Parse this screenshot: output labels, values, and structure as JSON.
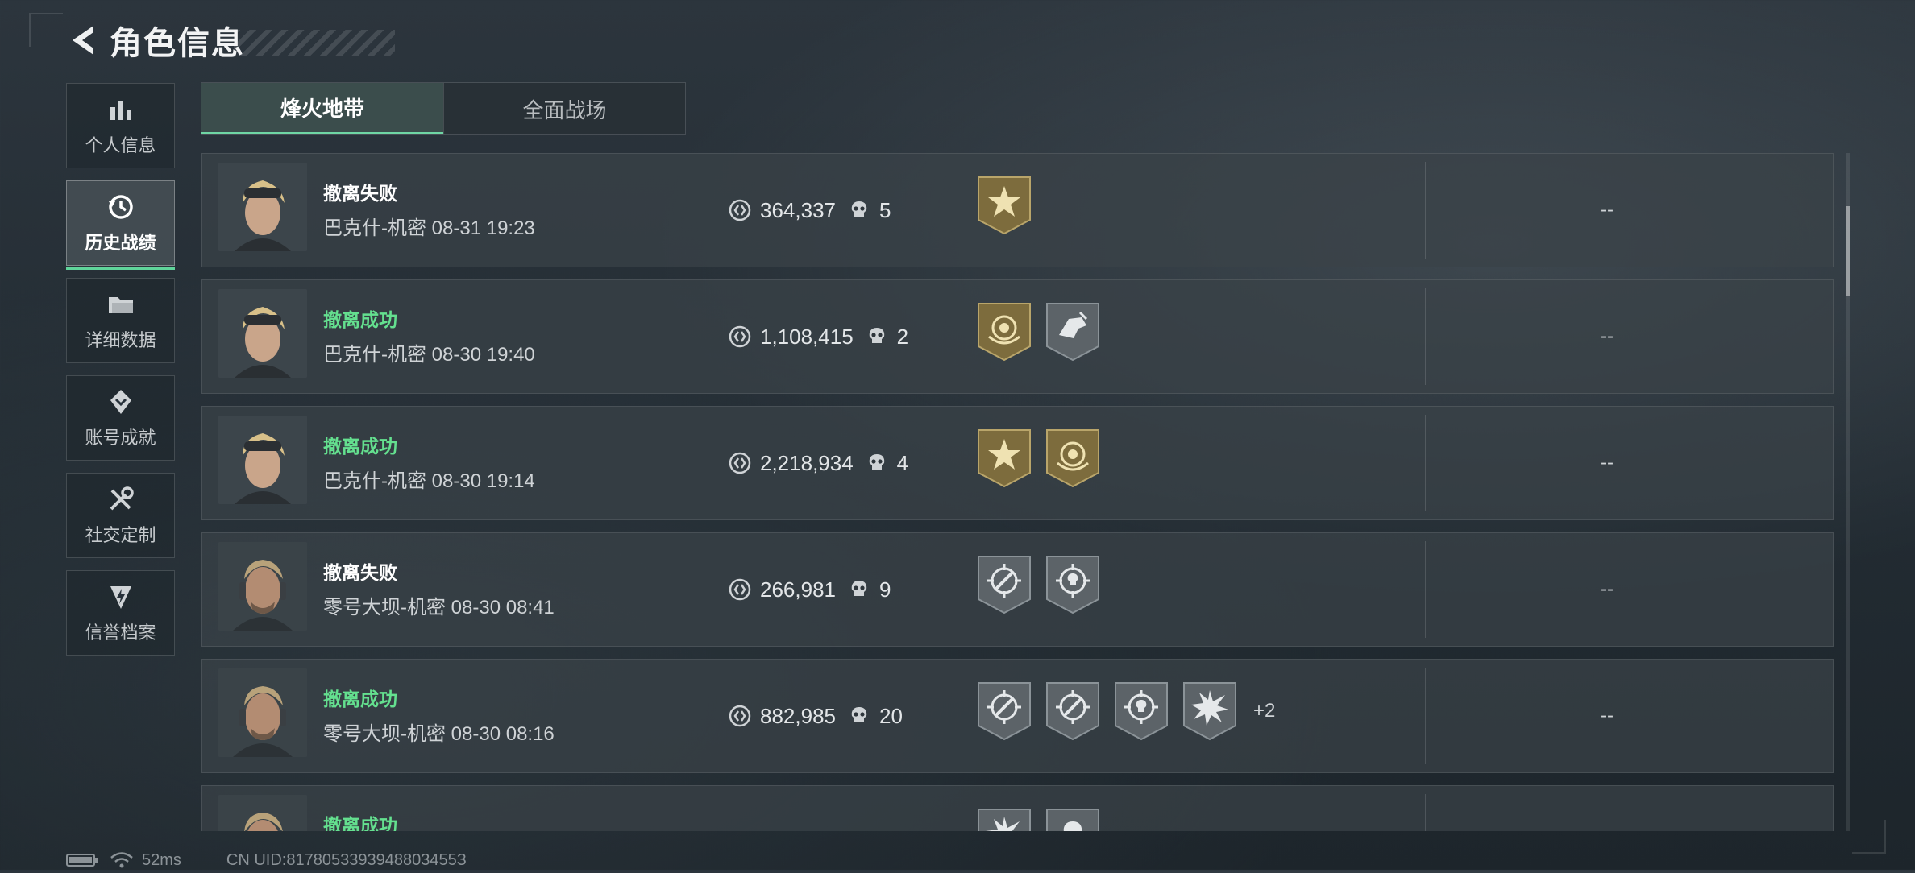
{
  "header": {
    "title": "角色信息"
  },
  "sidebar": {
    "items": [
      {
        "label": "个人信息",
        "icon": "bar-chart-icon"
      },
      {
        "label": "历史战绩",
        "icon": "history-clock-icon"
      },
      {
        "label": "详细数据",
        "icon": "folder-icon"
      },
      {
        "label": "账号成就",
        "icon": "achievement-icon"
      },
      {
        "label": "社交定制",
        "icon": "tools-icon"
      },
      {
        "label": "信誉档案",
        "icon": "shield-bolt-icon"
      }
    ],
    "active_index": 1
  },
  "tabs": [
    {
      "label": "烽火地带"
    },
    {
      "label": "全面战场"
    }
  ],
  "records": [
    {
      "status": "撤离失败",
      "map": "巴克什-机密",
      "time": "08-31 19:23",
      "value": "364,337",
      "kills": "5",
      "badges": [
        "gold-star-badge"
      ],
      "extra": "",
      "dash": "--"
    },
    {
      "status": "撤离成功",
      "map": "巴克什-机密",
      "time": "08-30 19:40",
      "value": "1,108,415",
      "kills": "2",
      "badges": [
        "gold-laurel-badge",
        "silver-hand-badge"
      ],
      "extra": "",
      "dash": "--"
    },
    {
      "status": "撤离成功",
      "map": "巴克什-机密",
      "time": "08-30 19:14",
      "value": "2,218,934",
      "kills": "4",
      "badges": [
        "gold-star-badge",
        "gold-laurel-badge"
      ],
      "extra": "",
      "dash": "--"
    },
    {
      "status": "撤离失败",
      "map": "零号大坝-机密",
      "time": "08-30 08:41",
      "value": "266,981",
      "kills": "9",
      "badges": [
        "silver-crosshair-badge",
        "silver-skull-crosshair-badge"
      ],
      "extra": "",
      "dash": "--"
    },
    {
      "status": "撤离成功",
      "map": "零号大坝-机密",
      "time": "08-30 08:16",
      "value": "882,985",
      "kills": "20",
      "badges": [
        "silver-crosshair-badge",
        "silver-crosshair-badge",
        "silver-skull-crosshair-badge",
        "silver-burst-badge"
      ],
      "extra": "+2",
      "dash": "--"
    },
    {
      "status": "撤离成功",
      "map": "",
      "time": "",
      "value": "",
      "kills": "",
      "badges": [
        "silver-burst-badge",
        "silver-skull-badge"
      ],
      "extra": "",
      "dash": ""
    }
  ],
  "statusbar": {
    "ping": "52ms",
    "uid": "CN UID:8178053393948803455З"
  },
  "colors": {
    "success": "#64e08f",
    "accent": "#6fd6a4",
    "gold": "#7d6c3d",
    "silver": "#5c6368"
  }
}
